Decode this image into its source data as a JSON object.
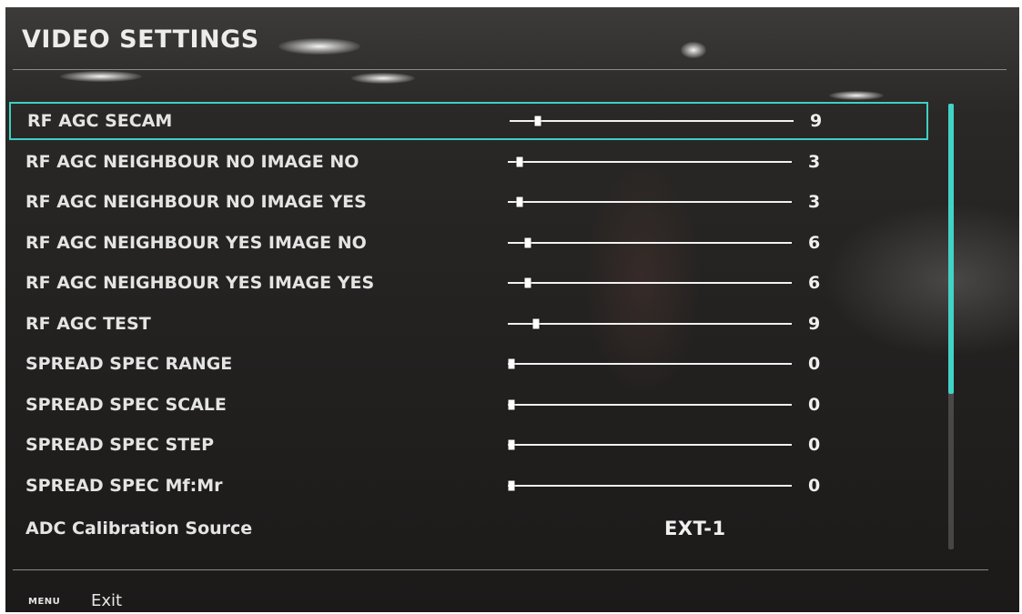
{
  "title": "VIDEO SETTINGS",
  "rows": [
    {
      "label": "RF AGC SECAM",
      "value": "9",
      "selected": true
    },
    {
      "label": "RF AGC NEIGHBOUR NO IMAGE NO",
      "value": "3",
      "selected": false
    },
    {
      "label": "RF AGC NEIGHBOUR NO IMAGE YES",
      "value": "3",
      "selected": false
    },
    {
      "label": "RF AGC NEIGHBOUR YES IMAGE NO",
      "value": "6",
      "selected": false
    },
    {
      "label": "RF AGC NEIGHBOUR YES IMAGE YES",
      "value": "6",
      "selected": false
    },
    {
      "label": "RF AGC TEST",
      "value": "9",
      "selected": false
    },
    {
      "label": "SPREAD SPEC RANGE",
      "value": "0",
      "selected": false
    },
    {
      "label": "SPREAD SPEC SCALE",
      "value": "0",
      "selected": false
    },
    {
      "label": "SPREAD SPEC STEP",
      "value": "0",
      "selected": false
    },
    {
      "label": "SPREAD SPEC Mf:Mr",
      "value": "0",
      "selected": false
    }
  ],
  "option_row": {
    "label": "ADC Calibration Source",
    "value": "EXT-1"
  },
  "scrollbar": {
    "visible_fraction": 0.65,
    "position_fraction": 0
  },
  "footer": {
    "key": "MENU",
    "label": "Exit"
  },
  "colors": {
    "accent": "#3fd0c3",
    "text": "#e4e4e4",
    "background": "#242221"
  }
}
